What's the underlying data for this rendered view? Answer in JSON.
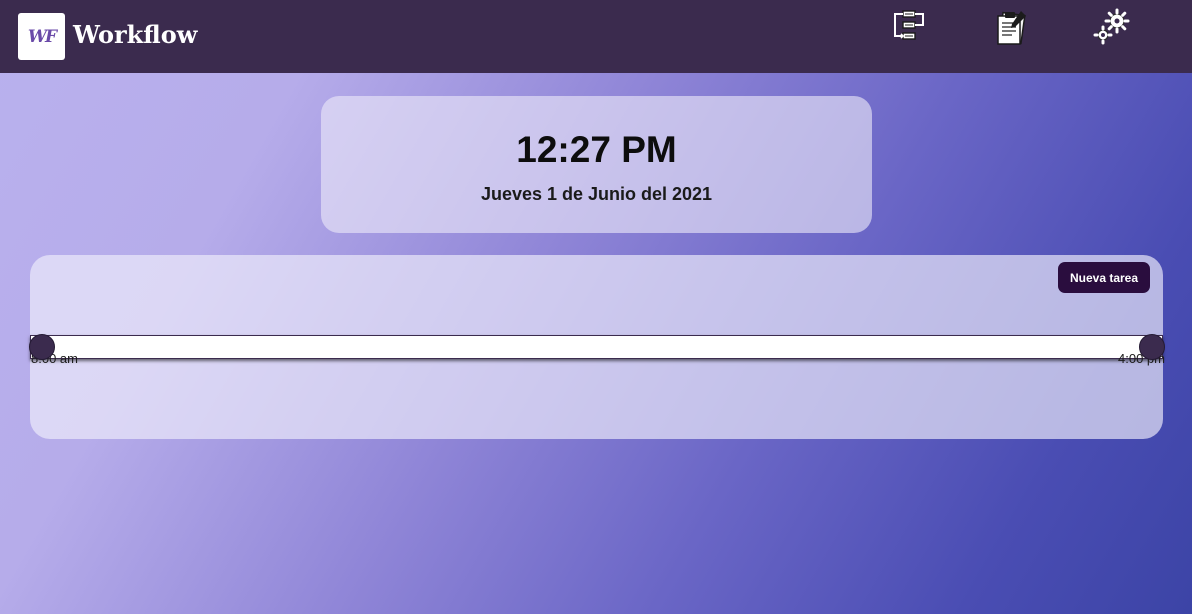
{
  "header": {
    "logo_text": "WF",
    "app_title": "Workflow",
    "nav_icons": [
      "flowchart-icon",
      "notes-icon",
      "settings-icon"
    ]
  },
  "clock": {
    "time": "12:27 PM",
    "date": "Jueves 1 de Junio del 2021"
  },
  "timeline": {
    "new_task_label": "Nueva tarea",
    "start_label": "8:00 am",
    "end_label": "4:00 pm"
  },
  "colors": {
    "topbar": "#3b2b4e",
    "button": "#2a0d3e",
    "gradient_start": "#b9b1ee",
    "gradient_end": "#3c44a6"
  }
}
